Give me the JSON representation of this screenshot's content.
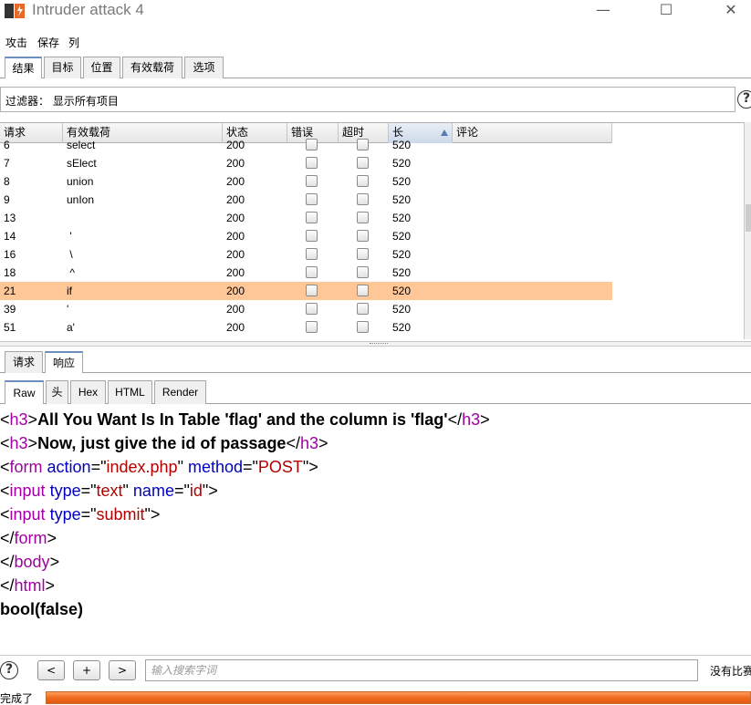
{
  "window": {
    "title": "Intruder attack 4",
    "minimize": "—",
    "maximize": "☐",
    "close": "✕"
  },
  "menu": [
    "攻击",
    "保存",
    "列"
  ],
  "tabs": [
    {
      "label": "结果",
      "active": true
    },
    {
      "label": "目标",
      "active": false
    },
    {
      "label": "位置",
      "active": false
    },
    {
      "label": "有效载荷",
      "active": false
    },
    {
      "label": "选项",
      "active": false
    }
  ],
  "filter": {
    "text": "过滤器： 显示所有项目",
    "help": "?"
  },
  "table": {
    "columns": [
      "请求",
      "有效载荷",
      "状态",
      "错误",
      "超时",
      "长",
      "评论"
    ],
    "sorted_column": "长",
    "rows": [
      {
        "request": "6",
        "payload": "select",
        "status": "200",
        "error": false,
        "timeout": false,
        "length": "520",
        "comment": "",
        "selected": false
      },
      {
        "request": "7",
        "payload": "sElect",
        "status": "200",
        "error": false,
        "timeout": false,
        "length": "520",
        "comment": "",
        "selected": false
      },
      {
        "request": "8",
        "payload": "union",
        "status": "200",
        "error": false,
        "timeout": false,
        "length": "520",
        "comment": "",
        "selected": false
      },
      {
        "request": "9",
        "payload": "unIon",
        "status": "200",
        "error": false,
        "timeout": false,
        "length": "520",
        "comment": "",
        "selected": false
      },
      {
        "request": "13",
        "payload": "",
        "status": "200",
        "error": false,
        "timeout": false,
        "length": "520",
        "comment": "",
        "selected": false
      },
      {
        "request": "14",
        "payload": " '",
        "status": "200",
        "error": false,
        "timeout": false,
        "length": "520",
        "comment": "",
        "selected": false
      },
      {
        "request": "16",
        "payload": " \\",
        "status": "200",
        "error": false,
        "timeout": false,
        "length": "520",
        "comment": "",
        "selected": false
      },
      {
        "request": "18",
        "payload": " ^",
        "status": "200",
        "error": false,
        "timeout": false,
        "length": "520",
        "comment": "",
        "selected": false
      },
      {
        "request": "21",
        "payload": "if",
        "status": "200",
        "error": false,
        "timeout": false,
        "length": "520",
        "comment": "",
        "selected": true
      },
      {
        "request": "39",
        "payload": "'",
        "status": "200",
        "error": false,
        "timeout": false,
        "length": "520",
        "comment": "",
        "selected": false
      },
      {
        "request": "51",
        "payload": "a'",
        "status": "200",
        "error": false,
        "timeout": false,
        "length": "520",
        "comment": "",
        "selected": false
      }
    ]
  },
  "subtabs": [
    {
      "label": "请求",
      "active": false
    },
    {
      "label": "响应",
      "active": true
    }
  ],
  "viewtabs": [
    {
      "label": "Raw",
      "active": true
    },
    {
      "label": "头",
      "active": false
    },
    {
      "label": "Hex",
      "active": false
    },
    {
      "label": "HTML",
      "active": false
    },
    {
      "label": "Render",
      "active": false
    }
  ],
  "response_lines": [
    [
      {
        "t": "<",
        "c": "plain"
      },
      {
        "t": "h3",
        "c": "tagname"
      },
      {
        "t": ">",
        "c": "plain"
      },
      {
        "t": "All You Want Is In Table 'flag' and the column is 'flag'",
        "c": "text-b"
      },
      {
        "t": "</",
        "c": "plain"
      },
      {
        "t": "h3",
        "c": "tagname"
      },
      {
        "t": ">",
        "c": "plain"
      }
    ],
    [
      {
        "t": "<",
        "c": "plain"
      },
      {
        "t": "h3",
        "c": "tagname"
      },
      {
        "t": ">",
        "c": "plain"
      },
      {
        "t": "Now, just give the id of passage",
        "c": "text-b"
      },
      {
        "t": "</",
        "c": "plain"
      },
      {
        "t": "h3",
        "c": "tagname"
      },
      {
        "t": ">",
        "c": "plain"
      }
    ],
    [
      {
        "t": "<",
        "c": "plain"
      },
      {
        "t": "form",
        "c": "tagname"
      },
      {
        "t": " ",
        "c": "plain"
      },
      {
        "t": "action",
        "c": "attr"
      },
      {
        "t": "=\"",
        "c": "plain"
      },
      {
        "t": "index.php",
        "c": "val"
      },
      {
        "t": "\" ",
        "c": "plain"
      },
      {
        "t": "method",
        "c": "attr"
      },
      {
        "t": "=\"",
        "c": "plain"
      },
      {
        "t": "POST",
        "c": "val"
      },
      {
        "t": "\">",
        "c": "plain"
      }
    ],
    [
      {
        "t": "<",
        "c": "plain"
      },
      {
        "t": "input",
        "c": "tagname"
      },
      {
        "t": " ",
        "c": "plain"
      },
      {
        "t": "type",
        "c": "attr"
      },
      {
        "t": "=\"",
        "c": "plain"
      },
      {
        "t": "text",
        "c": "val"
      },
      {
        "t": "\" ",
        "c": "plain"
      },
      {
        "t": "name",
        "c": "attr"
      },
      {
        "t": "=\"",
        "c": "plain"
      },
      {
        "t": "id",
        "c": "val"
      },
      {
        "t": "\">",
        "c": "plain"
      }
    ],
    [
      {
        "t": "<",
        "c": "plain"
      },
      {
        "t": "input",
        "c": "tagname"
      },
      {
        "t": " ",
        "c": "plain"
      },
      {
        "t": "type",
        "c": "attr"
      },
      {
        "t": "=\"",
        "c": "plain"
      },
      {
        "t": "submit",
        "c": "val"
      },
      {
        "t": "\">",
        "c": "plain"
      }
    ],
    [
      {
        "t": "</",
        "c": "plain"
      },
      {
        "t": "form",
        "c": "tagname"
      },
      {
        "t": ">",
        "c": "plain"
      }
    ],
    [
      {
        "t": "</",
        "c": "plain"
      },
      {
        "t": "body",
        "c": "tagname"
      },
      {
        "t": ">",
        "c": "plain"
      }
    ],
    [
      {
        "t": "</",
        "c": "plain"
      },
      {
        "t": "html",
        "c": "tagname"
      },
      {
        "t": ">",
        "c": "plain"
      }
    ],
    [
      {
        "t": "bool(false)",
        "c": "text-b"
      }
    ]
  ],
  "search": {
    "prev": "<",
    "add": "+",
    "next": ">",
    "placeholder": "输入搜索字词",
    "no_match": "没有比赛",
    "help": "?"
  },
  "status": {
    "text": "完成了",
    "progress": 1.0
  },
  "colors": {
    "selected_row": "#ffc797",
    "progress": "#f06a20",
    "tag": "#a000a0",
    "attribute": "#0000c0",
    "value": "#b00000"
  }
}
